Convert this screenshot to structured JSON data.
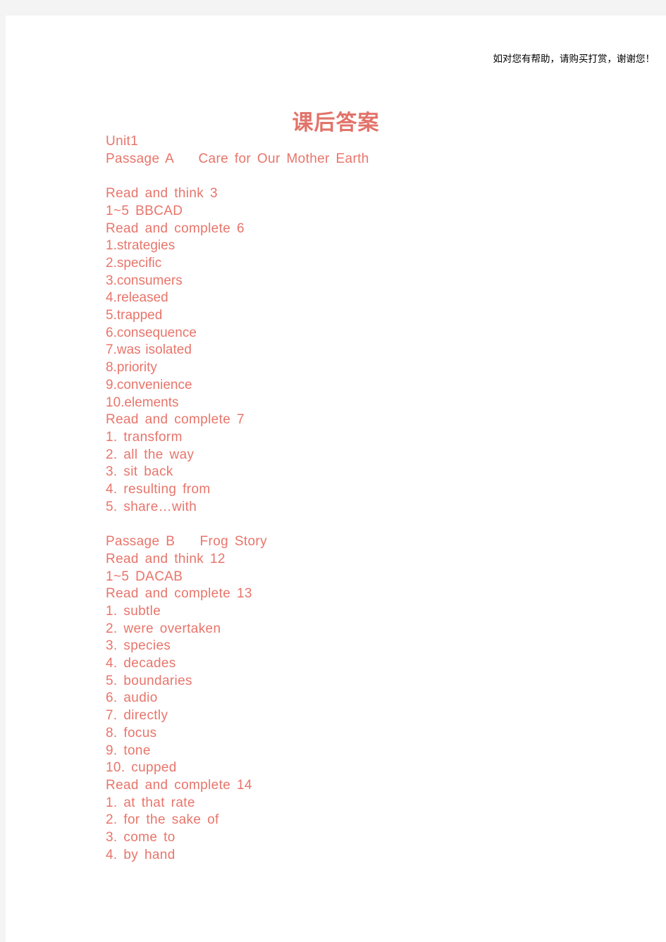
{
  "page": {
    "background_color": "#f4f4f4",
    "sheet_color": "#ffffff",
    "text_color": "#e8756b",
    "title_color": "#e2736a",
    "header_color": "#000000"
  },
  "header": {
    "promo_text": "如对您有帮助，请购买打赏，谢谢您！"
  },
  "title": {
    "text": "课后答案"
  },
  "body": {
    "lines": [
      {
        "text": "Unit1",
        "style": "sp"
      },
      {
        "text": "Passage A    Care for Our Mother Earth",
        "style": "sp"
      },
      {
        "text": "",
        "style": "blank"
      },
      {
        "text": "Read and think 3",
        "style": "sp"
      },
      {
        "text": "1~5 BBCAD",
        "style": "sp"
      },
      {
        "text": "Read and complete 6",
        "style": "sp"
      },
      {
        "text": "1.strategies",
        "style": "tight"
      },
      {
        "text": "2.specific",
        "style": "tight"
      },
      {
        "text": "3.consumers",
        "style": "tight"
      },
      {
        "text": "4.released",
        "style": "tight"
      },
      {
        "text": "5.trapped",
        "style": "tight"
      },
      {
        "text": "6.consequence",
        "style": "tight"
      },
      {
        "text": "7.was isolated",
        "style": "tight"
      },
      {
        "text": "8.priority",
        "style": "tight"
      },
      {
        "text": "9.convenience",
        "style": "tight"
      },
      {
        "text": "10.elements",
        "style": "tight"
      },
      {
        "text": "Read and complete 7",
        "style": "sp"
      },
      {
        "text": "1. transform",
        "style": "sp"
      },
      {
        "text": "2. all the way",
        "style": "sp"
      },
      {
        "text": "3. sit back",
        "style": "sp"
      },
      {
        "text": "4. resulting from",
        "style": "sp"
      },
      {
        "text": "5. share…with",
        "style": "sp"
      },
      {
        "text": "",
        "style": "blank"
      },
      {
        "text": "Passage B    Frog Story",
        "style": "sp"
      },
      {
        "text": "Read and think 12",
        "style": "sp"
      },
      {
        "text": "1~5 DACAB",
        "style": "sp"
      },
      {
        "text": "Read and complete 13",
        "style": "sp"
      },
      {
        "text": "1. subtle",
        "style": "sp"
      },
      {
        "text": "2. were overtaken",
        "style": "sp"
      },
      {
        "text": "3. species",
        "style": "sp"
      },
      {
        "text": "4. decades",
        "style": "sp"
      },
      {
        "text": "5. boundaries",
        "style": "sp"
      },
      {
        "text": "6. audio",
        "style": "sp"
      },
      {
        "text": "7. directly",
        "style": "sp"
      },
      {
        "text": "8. focus",
        "style": "sp"
      },
      {
        "text": "9. tone",
        "style": "sp"
      },
      {
        "text": "10. cupped",
        "style": "sp"
      },
      {
        "text": "Read and complete 14",
        "style": "sp"
      },
      {
        "text": "1. at that rate",
        "style": "sp"
      },
      {
        "text": "2. for the sake of",
        "style": "sp"
      },
      {
        "text": "3. come to",
        "style": "sp"
      },
      {
        "text": "4. by hand",
        "style": "sp"
      }
    ]
  }
}
